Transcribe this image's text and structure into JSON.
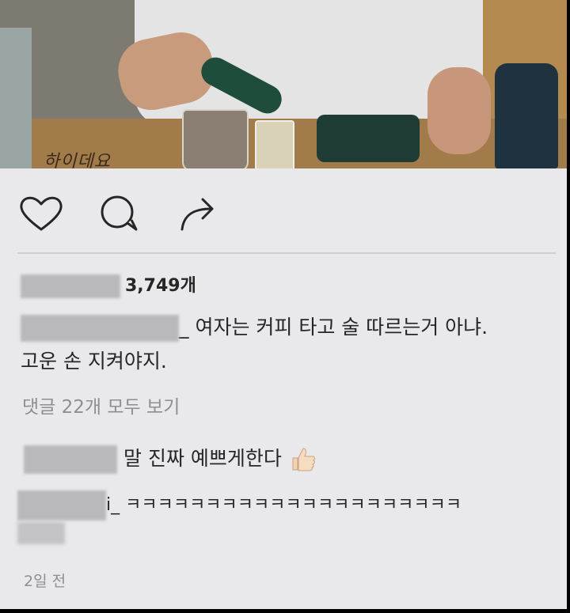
{
  "photo": {
    "sign_text": "하이데요"
  },
  "actions": {
    "like_icon": "heart-icon",
    "comment_icon": "comment-icon",
    "share_icon": "share-icon"
  },
  "likes": {
    "count_text": "3,749개"
  },
  "caption": {
    "text_line1": "_ 여자는 커피 타고 술 따르는거 아냐.",
    "text_line2": "고운 손 지켜야지."
  },
  "comments_link": "댓글 22개 모두 보기",
  "comments": [
    {
      "text": "말 진짜 예쁘게한다",
      "emoji": "thumbs-up"
    },
    {
      "text": "i_ ㅋㅋㅋㅋㅋㅋㅋㅋㅋㅋㅋㅋㅋㅋㅋㅋㅋㅋㅋㅋㅋ"
    }
  ],
  "timestamp": "2일 전",
  "colors": {
    "text": "#262626",
    "muted": "#8e8e8e",
    "background": "#e9e9eb"
  }
}
